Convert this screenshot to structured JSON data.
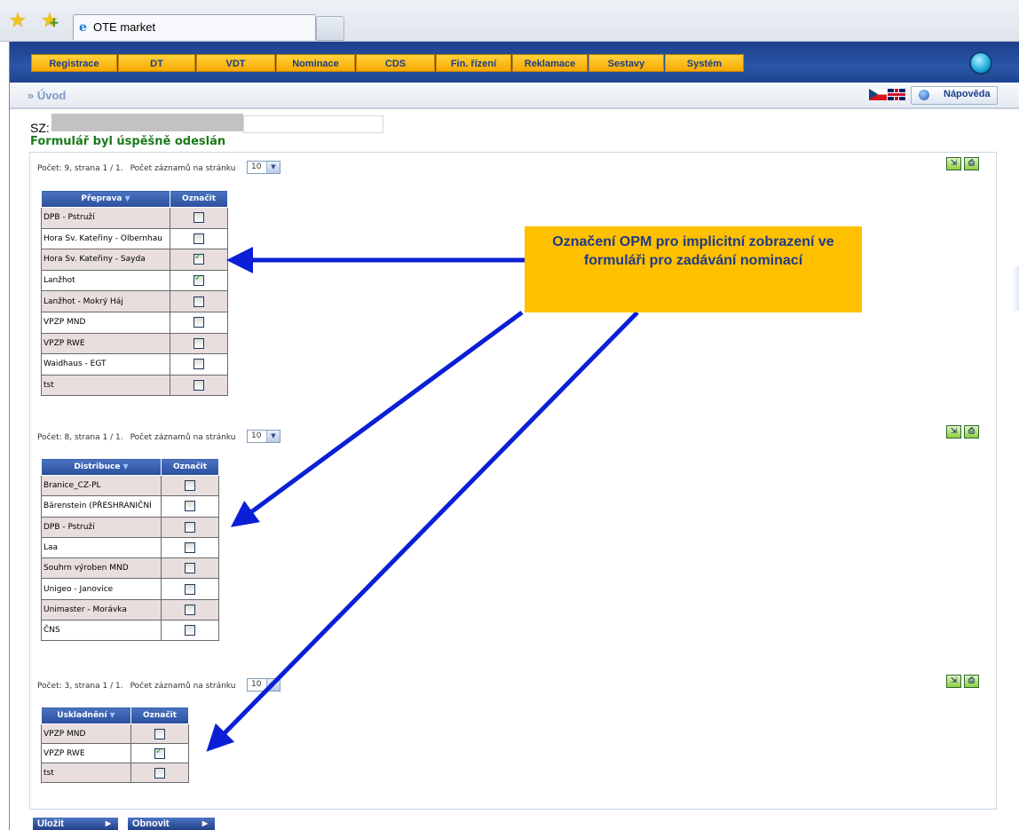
{
  "browser": {
    "tab_title": "OTE market"
  },
  "nav": {
    "items": [
      "Registrace",
      "DT",
      "VDT",
      "Nominace",
      "CDS",
      "Fin. řízení",
      "Reklamace",
      "Sestavy",
      "Systém"
    ]
  },
  "breadcrumb": "» Úvod",
  "help_label": "Nápověda",
  "sz_label": "SZ:",
  "success_message": "Formulář byl úspěšně odeslán",
  "page_size_label": "Počet záznamů na stránku",
  "page_size_value": "10",
  "tables": [
    {
      "pager": "Počet: 9, strana 1 / 1.",
      "header": "Přeprava",
      "mark_header": "Označit",
      "rows": [
        {
          "name": "DPB - Pstruží",
          "checked": false
        },
        {
          "name": "Hora Sv. Kateřiny - Olbernhau",
          "checked": false
        },
        {
          "name": "Hora Sv. Kateřiny - Sayda",
          "checked": true
        },
        {
          "name": "Lanžhot",
          "checked": true
        },
        {
          "name": "Lanžhot - Mokrý Háj",
          "checked": false
        },
        {
          "name": "VPZP MND",
          "checked": false
        },
        {
          "name": "VPZP RWE",
          "checked": false
        },
        {
          "name": "Waidhaus - EGT",
          "checked": false
        },
        {
          "name": "tst",
          "checked": false
        }
      ]
    },
    {
      "pager": "Počet: 8, strana 1 / 1.",
      "header": "Distribuce",
      "mark_header": "Označit",
      "rows": [
        {
          "name": "Branice_CZ-PL",
          "checked": false
        },
        {
          "name": "Bärenstein (PŘESHRANIČNÍ",
          "checked": false
        },
        {
          "name": "DPB - Pstruží",
          "checked": false
        },
        {
          "name": "Laa",
          "checked": false
        },
        {
          "name": "Souhrn výroben MND",
          "checked": false
        },
        {
          "name": "Unigeo - Janovice",
          "checked": false
        },
        {
          "name": "Unimaster - Morávka",
          "checked": false
        },
        {
          "name": "ČNS",
          "checked": false
        }
      ]
    },
    {
      "pager": "Počet: 3, strana 1 / 1.",
      "header": "Uskladnění",
      "mark_header": "Označit",
      "rows": [
        {
          "name": "VPZP MND",
          "checked": false
        },
        {
          "name": "VPZP RWE",
          "checked": true
        },
        {
          "name": "tst",
          "checked": false
        }
      ]
    }
  ],
  "callout_text": "Označení OPM pro implicitní zobrazení ve formuláři pro zadávání nominací",
  "buttons": {
    "save": "Uložit",
    "refresh": "Obnovit"
  },
  "colors": {
    "header_blue": "#2b56a6",
    "nav_yellow": "#ffc000",
    "success_green": "#1b7a1b",
    "arrow_blue": "#0a1fd6"
  }
}
